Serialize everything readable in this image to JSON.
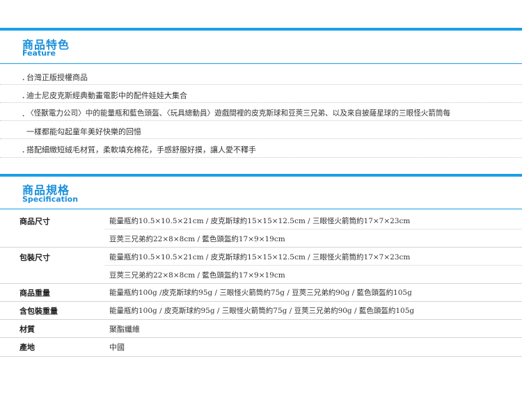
{
  "feature": {
    "title_zh": "商品特色",
    "title_en": "Feature",
    "bullet": "．",
    "items": [
      "台灣正版授權商品",
      "迪士尼皮克斯經典動畫電影中的配件娃娃大集合",
      "〈怪獸電力公司〉中的能量瓶和藍色頭盔、〈玩具總動員〉遊戲間裡的皮克斯球和豆莢三兄弟、以及來自披薩星球的三眼怪火箭筒每",
      "一樣都能勾起童年美好快樂的回憶",
      "搭配細緻短絨毛材質，柔軟填充棉花，手感舒服好摸，讓人愛不釋手"
    ]
  },
  "spec": {
    "title_zh": "商品規格",
    "title_en": "Specification",
    "rows": [
      {
        "label": "商品尺寸",
        "value": "能量瓶約10.5×10.5×21cm / 皮克斯球約15×15×12.5cm / 三眼怪火箭筒約17×7×23cm"
      },
      {
        "label": "",
        "value": "豆莢三兄弟約22×8×8cm / 藍色頭盔約17×9×19cm"
      },
      {
        "label": "包裝尺寸",
        "value": "能量瓶約10.5×10.5×21cm / 皮克斯球約15×15×12.5cm / 三眼怪火箭筒約17×7×23cm"
      },
      {
        "label": "",
        "value": "豆莢三兄弟約22×8×8cm / 藍色頭盔約17×9×19cm"
      },
      {
        "label": "商品重量",
        "value": "能量瓶約100g /皮克斯球約95g / 三眼怪火箭筒約75g / 豆莢三兄弟約90g / 藍色頭盔約105g"
      },
      {
        "label": "含包裝重量",
        "value": "能量瓶約100g / 皮克斯球約95g / 三眼怪火箭筒約75g / 豆莢三兄弟約90g / 藍色頭盔約105g"
      },
      {
        "label": "材質",
        "value": "聚酯纖維"
      },
      {
        "label": "產地",
        "value": "中國"
      }
    ]
  },
  "colors": {
    "accent": "#1a9ee8"
  }
}
